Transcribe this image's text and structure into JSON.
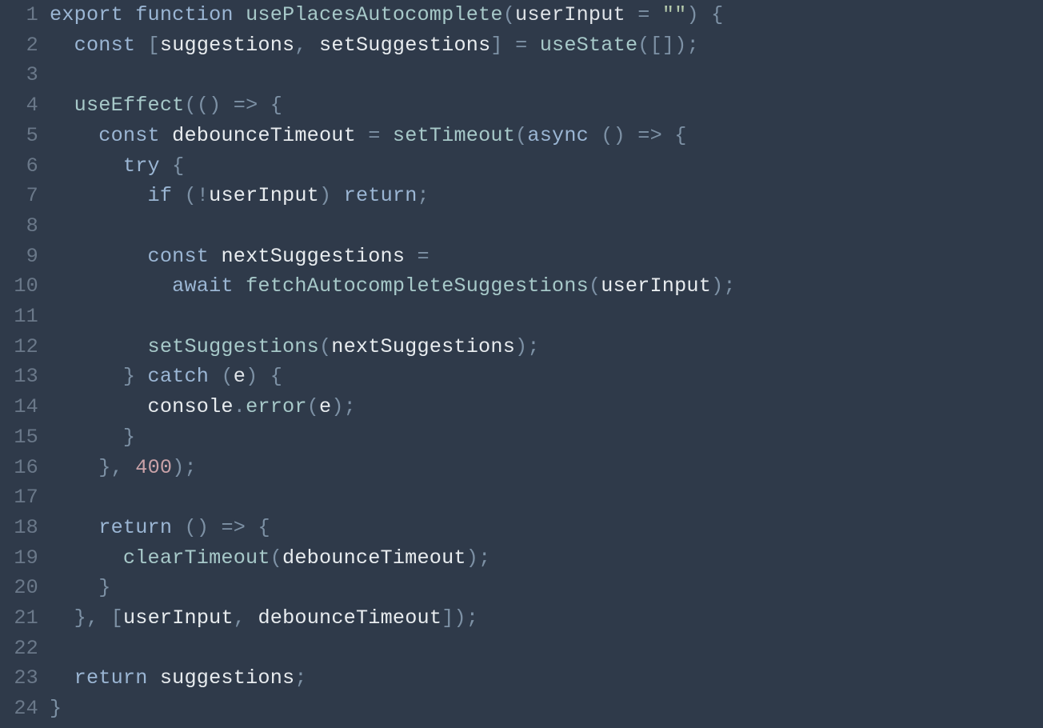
{
  "lines": [
    {
      "n": "1",
      "tokens": [
        {
          "t": "export",
          "c": "kw"
        },
        {
          "t": " ",
          "c": "id"
        },
        {
          "t": "function",
          "c": "kw"
        },
        {
          "t": " ",
          "c": "id"
        },
        {
          "t": "usePlacesAutocomplete",
          "c": "fn"
        },
        {
          "t": "(",
          "c": "punc"
        },
        {
          "t": "userInput",
          "c": "parm"
        },
        {
          "t": " ",
          "c": "id"
        },
        {
          "t": "=",
          "c": "punc"
        },
        {
          "t": " ",
          "c": "id"
        },
        {
          "t": "\"\"",
          "c": "str"
        },
        {
          "t": ")",
          "c": "punc"
        },
        {
          "t": " ",
          "c": "id"
        },
        {
          "t": "{",
          "c": "punc"
        }
      ]
    },
    {
      "n": "2",
      "tokens": [
        {
          "t": "  ",
          "c": "id"
        },
        {
          "t": "const",
          "c": "kw"
        },
        {
          "t": " ",
          "c": "id"
        },
        {
          "t": "[",
          "c": "punc"
        },
        {
          "t": "suggestions",
          "c": "id"
        },
        {
          "t": ",",
          "c": "punc"
        },
        {
          "t": " ",
          "c": "id"
        },
        {
          "t": "setSuggestions",
          "c": "id"
        },
        {
          "t": "]",
          "c": "punc"
        },
        {
          "t": " ",
          "c": "id"
        },
        {
          "t": "=",
          "c": "punc"
        },
        {
          "t": " ",
          "c": "id"
        },
        {
          "t": "useState",
          "c": "fn"
        },
        {
          "t": "(",
          "c": "punc"
        },
        {
          "t": "[",
          "c": "punc"
        },
        {
          "t": "]",
          "c": "punc"
        },
        {
          "t": ")",
          "c": "punc"
        },
        {
          "t": ";",
          "c": "punc"
        }
      ]
    },
    {
      "n": "3",
      "tokens": [
        {
          "t": "",
          "c": "id"
        }
      ]
    },
    {
      "n": "4",
      "tokens": [
        {
          "t": "  ",
          "c": "id"
        },
        {
          "t": "useEffect",
          "c": "fn"
        },
        {
          "t": "(",
          "c": "punc"
        },
        {
          "t": "(",
          "c": "punc"
        },
        {
          "t": ")",
          "c": "punc"
        },
        {
          "t": " ",
          "c": "id"
        },
        {
          "t": "=>",
          "c": "punc"
        },
        {
          "t": " ",
          "c": "id"
        },
        {
          "t": "{",
          "c": "punc"
        }
      ]
    },
    {
      "n": "5",
      "tokens": [
        {
          "t": "    ",
          "c": "id"
        },
        {
          "t": "const",
          "c": "kw"
        },
        {
          "t": " ",
          "c": "id"
        },
        {
          "t": "debounceTimeout",
          "c": "id"
        },
        {
          "t": " ",
          "c": "id"
        },
        {
          "t": "=",
          "c": "punc"
        },
        {
          "t": " ",
          "c": "id"
        },
        {
          "t": "setTimeout",
          "c": "fn"
        },
        {
          "t": "(",
          "c": "punc"
        },
        {
          "t": "async",
          "c": "kw"
        },
        {
          "t": " ",
          "c": "id"
        },
        {
          "t": "(",
          "c": "punc"
        },
        {
          "t": ")",
          "c": "punc"
        },
        {
          "t": " ",
          "c": "id"
        },
        {
          "t": "=>",
          "c": "punc"
        },
        {
          "t": " ",
          "c": "id"
        },
        {
          "t": "{",
          "c": "punc"
        }
      ]
    },
    {
      "n": "6",
      "tokens": [
        {
          "t": "      ",
          "c": "id"
        },
        {
          "t": "try",
          "c": "kw"
        },
        {
          "t": " ",
          "c": "id"
        },
        {
          "t": "{",
          "c": "punc"
        }
      ]
    },
    {
      "n": "7",
      "tokens": [
        {
          "t": "        ",
          "c": "id"
        },
        {
          "t": "if",
          "c": "kw"
        },
        {
          "t": " ",
          "c": "id"
        },
        {
          "t": "(",
          "c": "punc"
        },
        {
          "t": "!",
          "c": "punc"
        },
        {
          "t": "userInput",
          "c": "id"
        },
        {
          "t": ")",
          "c": "punc"
        },
        {
          "t": " ",
          "c": "id"
        },
        {
          "t": "return",
          "c": "kw"
        },
        {
          "t": ";",
          "c": "punc"
        }
      ]
    },
    {
      "n": "8",
      "tokens": [
        {
          "t": "",
          "c": "id"
        }
      ]
    },
    {
      "n": "9",
      "tokens": [
        {
          "t": "        ",
          "c": "id"
        },
        {
          "t": "const",
          "c": "kw"
        },
        {
          "t": " ",
          "c": "id"
        },
        {
          "t": "nextSuggestions",
          "c": "id"
        },
        {
          "t": " ",
          "c": "id"
        },
        {
          "t": "=",
          "c": "punc"
        }
      ]
    },
    {
      "n": "10",
      "tokens": [
        {
          "t": "          ",
          "c": "id"
        },
        {
          "t": "await",
          "c": "kw"
        },
        {
          "t": " ",
          "c": "id"
        },
        {
          "t": "fetchAutocompleteSuggestions",
          "c": "fn"
        },
        {
          "t": "(",
          "c": "punc"
        },
        {
          "t": "userInput",
          "c": "id"
        },
        {
          "t": ")",
          "c": "punc"
        },
        {
          "t": ";",
          "c": "punc"
        }
      ]
    },
    {
      "n": "11",
      "tokens": [
        {
          "t": "",
          "c": "id"
        }
      ]
    },
    {
      "n": "12",
      "tokens": [
        {
          "t": "        ",
          "c": "id"
        },
        {
          "t": "setSuggestions",
          "c": "fn"
        },
        {
          "t": "(",
          "c": "punc"
        },
        {
          "t": "nextSuggestions",
          "c": "id"
        },
        {
          "t": ")",
          "c": "punc"
        },
        {
          "t": ";",
          "c": "punc"
        }
      ]
    },
    {
      "n": "13",
      "tokens": [
        {
          "t": "      ",
          "c": "id"
        },
        {
          "t": "}",
          "c": "punc"
        },
        {
          "t": " ",
          "c": "id"
        },
        {
          "t": "catch",
          "c": "kw"
        },
        {
          "t": " ",
          "c": "id"
        },
        {
          "t": "(",
          "c": "punc"
        },
        {
          "t": "e",
          "c": "parm"
        },
        {
          "t": ")",
          "c": "punc"
        },
        {
          "t": " ",
          "c": "id"
        },
        {
          "t": "{",
          "c": "punc"
        }
      ]
    },
    {
      "n": "14",
      "tokens": [
        {
          "t": "        ",
          "c": "id"
        },
        {
          "t": "console",
          "c": "id"
        },
        {
          "t": ".",
          "c": "punc"
        },
        {
          "t": "error",
          "c": "fn"
        },
        {
          "t": "(",
          "c": "punc"
        },
        {
          "t": "e",
          "c": "id"
        },
        {
          "t": ")",
          "c": "punc"
        },
        {
          "t": ";",
          "c": "punc"
        }
      ]
    },
    {
      "n": "15",
      "tokens": [
        {
          "t": "      ",
          "c": "id"
        },
        {
          "t": "}",
          "c": "punc"
        }
      ]
    },
    {
      "n": "16",
      "tokens": [
        {
          "t": "    ",
          "c": "id"
        },
        {
          "t": "}",
          "c": "punc"
        },
        {
          "t": ",",
          "c": "punc"
        },
        {
          "t": " ",
          "c": "id"
        },
        {
          "t": "400",
          "c": "num"
        },
        {
          "t": ")",
          "c": "punc"
        },
        {
          "t": ";",
          "c": "punc"
        }
      ]
    },
    {
      "n": "17",
      "tokens": [
        {
          "t": "",
          "c": "id"
        }
      ]
    },
    {
      "n": "18",
      "tokens": [
        {
          "t": "    ",
          "c": "id"
        },
        {
          "t": "return",
          "c": "kw"
        },
        {
          "t": " ",
          "c": "id"
        },
        {
          "t": "(",
          "c": "punc"
        },
        {
          "t": ")",
          "c": "punc"
        },
        {
          "t": " ",
          "c": "id"
        },
        {
          "t": "=>",
          "c": "punc"
        },
        {
          "t": " ",
          "c": "id"
        },
        {
          "t": "{",
          "c": "punc"
        }
      ]
    },
    {
      "n": "19",
      "tokens": [
        {
          "t": "      ",
          "c": "id"
        },
        {
          "t": "clearTimeout",
          "c": "fn"
        },
        {
          "t": "(",
          "c": "punc"
        },
        {
          "t": "debounceTimeout",
          "c": "id"
        },
        {
          "t": ")",
          "c": "punc"
        },
        {
          "t": ";",
          "c": "punc"
        }
      ]
    },
    {
      "n": "20",
      "tokens": [
        {
          "t": "    ",
          "c": "id"
        },
        {
          "t": "}",
          "c": "punc"
        }
      ]
    },
    {
      "n": "21",
      "tokens": [
        {
          "t": "  ",
          "c": "id"
        },
        {
          "t": "}",
          "c": "punc"
        },
        {
          "t": ",",
          "c": "punc"
        },
        {
          "t": " ",
          "c": "id"
        },
        {
          "t": "[",
          "c": "punc"
        },
        {
          "t": "userInput",
          "c": "id"
        },
        {
          "t": ",",
          "c": "punc"
        },
        {
          "t": " ",
          "c": "id"
        },
        {
          "t": "debounceTimeout",
          "c": "id"
        },
        {
          "t": "]",
          "c": "punc"
        },
        {
          "t": ")",
          "c": "punc"
        },
        {
          "t": ";",
          "c": "punc"
        }
      ]
    },
    {
      "n": "22",
      "tokens": [
        {
          "t": "",
          "c": "id"
        }
      ]
    },
    {
      "n": "23",
      "tokens": [
        {
          "t": "  ",
          "c": "id"
        },
        {
          "t": "return",
          "c": "kw"
        },
        {
          "t": " ",
          "c": "id"
        },
        {
          "t": "suggestions",
          "c": "id"
        },
        {
          "t": ";",
          "c": "punc"
        }
      ]
    },
    {
      "n": "24",
      "tokens": [
        {
          "t": "}",
          "c": "punc"
        }
      ]
    }
  ]
}
